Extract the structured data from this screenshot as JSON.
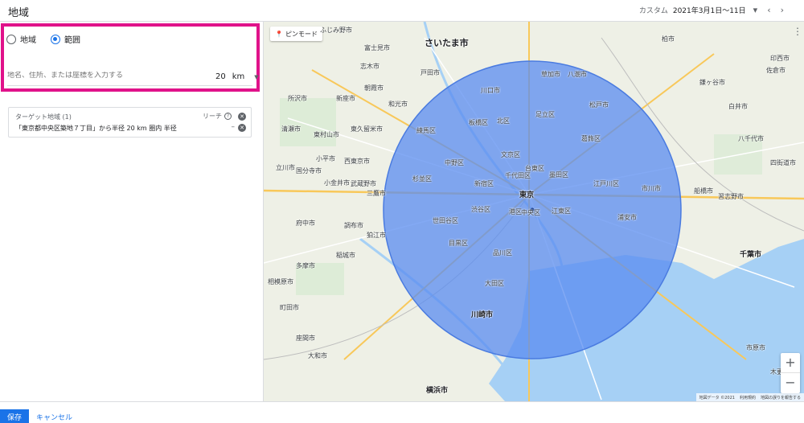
{
  "header": {
    "title": "地域",
    "date_label": "カスタム",
    "date_range": "2021年3月1日〜11日",
    "dropdown_icon": "caret-down-icon",
    "prev_icon": "chevron-left-icon",
    "next_icon": "chevron-right-icon"
  },
  "panel": {
    "radio_options": [
      {
        "label": "地域",
        "checked": false
      },
      {
        "label": "範囲",
        "checked": true
      }
    ],
    "location_placeholder": "地名、住所、または座標を入力する",
    "radius_value": "20",
    "radius_unit": "km",
    "target": {
      "title": "ターゲット地域 (1)",
      "reach_label": "リーチ",
      "item": "「東京都中央区築地７丁目」から半径 20 km 圏内 半径",
      "reach_value": "–"
    }
  },
  "map": {
    "pin_mode_label": "ピンモード",
    "labels": [
      "ふじみ野市",
      "富士見市",
      "さいたま市",
      "志木市",
      "朝霞市",
      "川口市",
      "草加市",
      "八潮市",
      "柏市",
      "新座市",
      "戸田市",
      "和光市",
      "練馬区",
      "板橋区",
      "北区",
      "足立区",
      "葛飾区",
      "松戸市",
      "所沢市",
      "東村山市",
      "東久留米市",
      "西東京市",
      "清瀬市",
      "小平市",
      "国分寺市",
      "立川市",
      "小金井市",
      "武蔵野市",
      "三鷹市",
      "杉並区",
      "中野区",
      "新宿区",
      "文京区",
      "台東区",
      "墨田区",
      "江戸川区",
      "市川市",
      "船橋市",
      "東京",
      "千代田区",
      "中央区",
      "港区",
      "江東区",
      "浦安市",
      "習志野市",
      "千葉市",
      "府中市",
      "調布市",
      "狛江市",
      "世田谷区",
      "渋谷区",
      "目黒区",
      "品川区",
      "大田区",
      "多摩市",
      "稲城市",
      "町田市",
      "川崎市",
      "横浜市",
      "大和市",
      "座間市",
      "相模原市",
      "鎌ヶ谷市",
      "白井市",
      "印西市",
      "八千代市",
      "佐倉市",
      "四街道市",
      "木更津",
      "市原市"
    ],
    "attribution": [
      "地図データ ©2021",
      "利用規約",
      "地図の誤りを報告する"
    ],
    "zoom_in": "+",
    "zoom_out": "−",
    "colors": {
      "circle_fill": "#5a8cf0",
      "circle_stroke": "#4a7be0",
      "water": "#a6d0f5",
      "land": "#eef0e6"
    }
  },
  "footer": {
    "save_label": "保存",
    "cancel_label": "キャンセル"
  }
}
